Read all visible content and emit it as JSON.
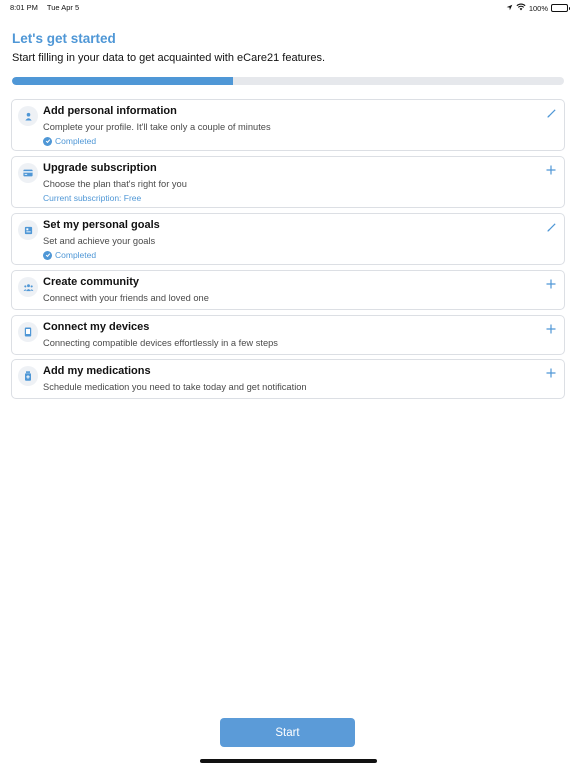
{
  "status_bar": {
    "time": "8:01 PM",
    "date": "Tue Apr 5",
    "battery": "100%",
    "icons": [
      "location-icon",
      "wifi-icon",
      "battery-icon"
    ]
  },
  "header": {
    "title": "Let's get started",
    "subtitle": "Start filling in your data to get acquainted with eCare21 features."
  },
  "progress": {
    "fraction": 0.4
  },
  "cards": [
    {
      "title": "Add personal information",
      "description": "Complete your profile. It'll take only a couple of minutes",
      "status": "Completed",
      "icon": "person-icon",
      "action": "edit-icon"
    },
    {
      "title": "Upgrade subscription",
      "description": "Choose the plan that's right for you",
      "status": "Current subscription: Free",
      "icon": "credit-card-icon",
      "action": "add-icon"
    },
    {
      "title": "Set my personal goals",
      "description": "Set and achieve your goals",
      "status": "Completed",
      "icon": "goals-icon",
      "action": "edit-icon"
    },
    {
      "title": "Create community",
      "description": "Connect with your friends and loved one",
      "status": "",
      "icon": "community-icon",
      "action": "add-icon"
    },
    {
      "title": "Connect my devices",
      "description": "Connecting compatible devices effortlessly in a few steps",
      "status": "",
      "icon": "device-icon",
      "action": "add-icon"
    },
    {
      "title": "Add my medications",
      "description": "Schedule medication you need to take today and get notification",
      "status": "",
      "icon": "medication-icon",
      "action": "add-icon"
    }
  ],
  "start_button": {
    "label": "Start"
  },
  "colors": {
    "accent": "#4f97d6",
    "button": "#5b9bd8",
    "card_border": "#dcdfe4",
    "progress_track": "#e6e8ec"
  }
}
